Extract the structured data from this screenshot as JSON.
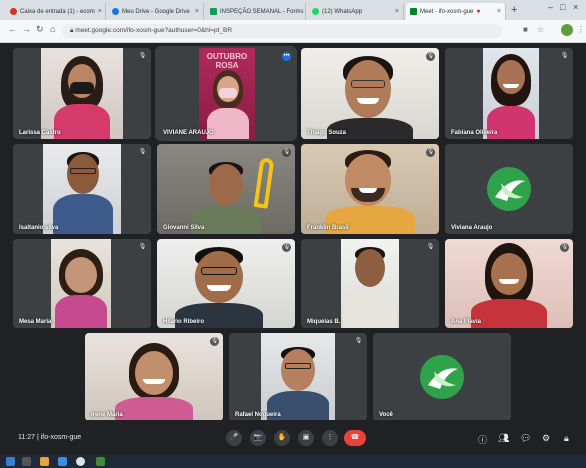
{
  "browser": {
    "tabs": [
      {
        "label": "Caixa de entrada (1) - ecom",
        "color": "#d93025"
      },
      {
        "label": "Meu Drive - Google Drive",
        "color": "#1a73e8"
      },
      {
        "label": "INSPEÇÃO SEMANAL - Forms",
        "color": "#0f9d58"
      },
      {
        "label": "(12) WhatsApp",
        "color": "#25d366"
      },
      {
        "label": "Meet - ifo-xosm-gue",
        "color": "#00832d",
        "active": true
      }
    ],
    "url": "meet.google.com/ifo-xosm-gue?authuser=0&hl=pt_BR"
  },
  "participants": [
    {
      "name": "Larissa Castro"
    },
    {
      "name": "VIVIANE ARAUJO",
      "poster_text": "OUTUBRO ROSA"
    },
    {
      "name": "Thiago Souza"
    },
    {
      "name": "Fabiana Oliveira"
    },
    {
      "name": "Isaltanio silva"
    },
    {
      "name": "Giovanni Silva"
    },
    {
      "name": "Franklin Brasil"
    },
    {
      "name": "Viviana Araujo"
    },
    {
      "name": "Mesa Maria"
    },
    {
      "name": "Hilario Ribeiro"
    },
    {
      "name": "Miqueias B."
    },
    {
      "name": "Ana Flavia"
    },
    {
      "name": "Irene Maria"
    },
    {
      "name": "Rafael Nogueira"
    },
    {
      "name": "Você"
    }
  ],
  "meeting": {
    "time": "11:27",
    "code": "ifo-xosm-gue"
  },
  "controls": {
    "mic": "🎤",
    "camera": "📷",
    "hand": "✋",
    "present": "▣",
    "more": "⋮",
    "end": "☎"
  }
}
